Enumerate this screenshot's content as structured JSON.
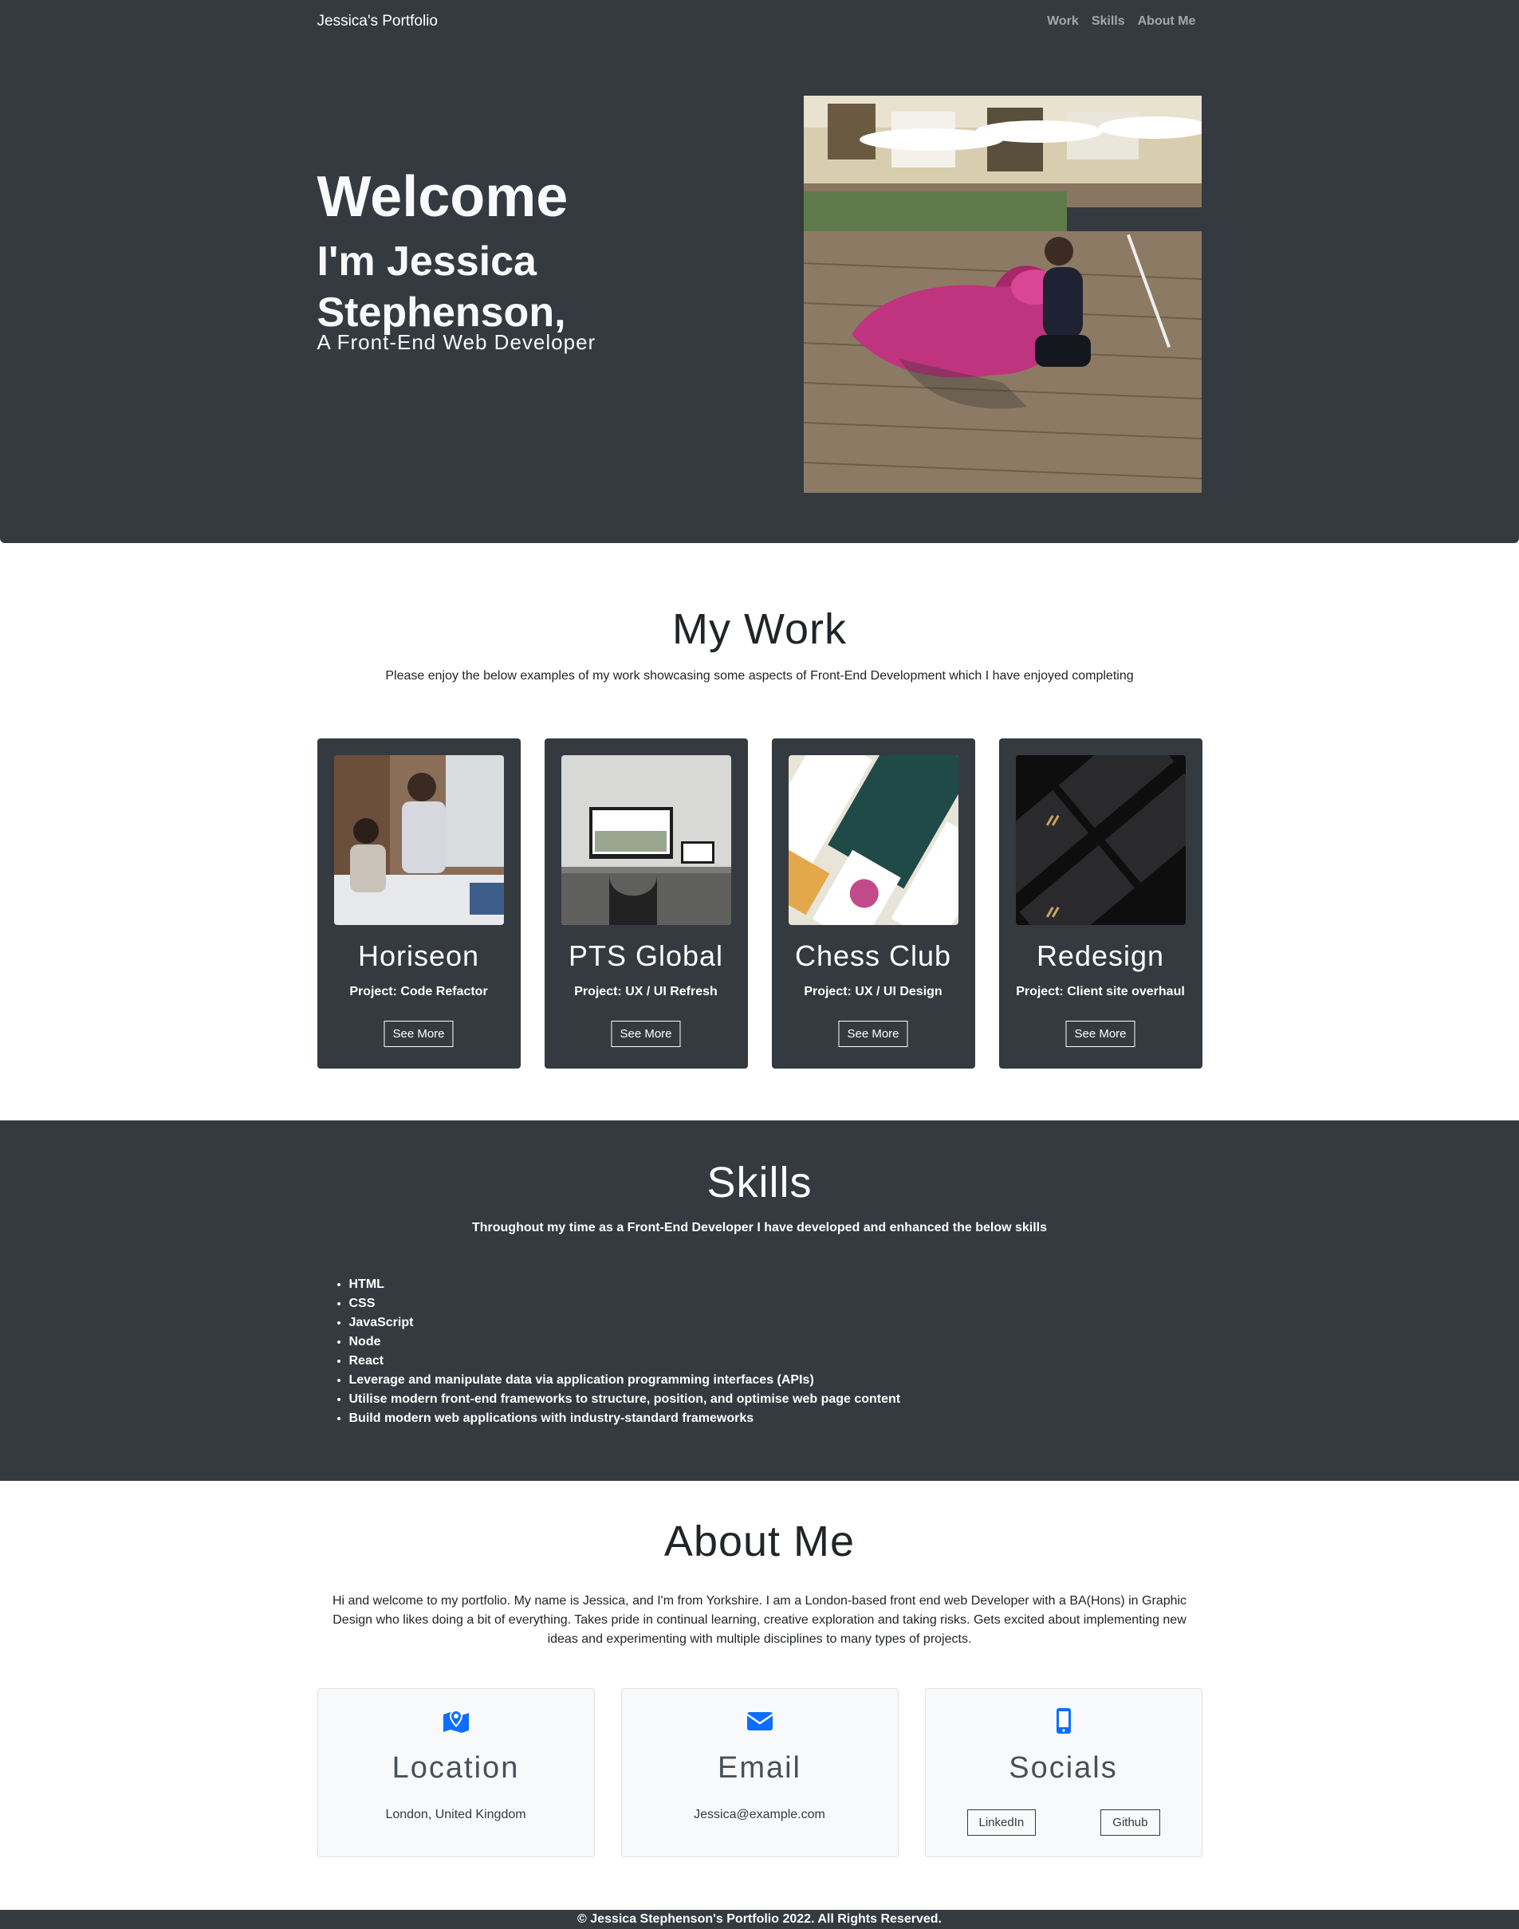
{
  "nav": {
    "brand": "Jessica's Portfolio",
    "links": [
      "Work",
      "Skills",
      "About Me"
    ]
  },
  "hero": {
    "title": "Welcome",
    "subtitle": "I'm Jessica Stephenson,",
    "role": "A Front-End Web Developer"
  },
  "work": {
    "title": "My Work",
    "lead": "Please enjoy the below examples of my work showcasing some aspects of Front-End Development which I have enjoyed completing",
    "projects": [
      {
        "title": "Horiseon",
        "subtitle": "Project: Code Refactor",
        "button": "See More"
      },
      {
        "title": "PTS Global",
        "subtitle": "Project: UX / UI Refresh",
        "button": "See More"
      },
      {
        "title": "Chess Club",
        "subtitle": "Project: UX / UI Design",
        "button": "See More"
      },
      {
        "title": "Redesign",
        "subtitle": "Project: Client site overhaul",
        "button": "See More"
      }
    ]
  },
  "skills": {
    "title": "Skills",
    "lead": "Throughout my time as a Front-End Developer I have developed and enhanced the below skills",
    "items": [
      "HTML",
      "CSS",
      "JavaScript",
      "Node",
      "React",
      "Leverage and manipulate data via application programming interfaces (APIs)",
      "Utilise modern front-end frameworks to structure, position, and optimise web page content",
      "Build modern web applications with industry-standard frameworks"
    ]
  },
  "about": {
    "title": "About Me",
    "text": "Hi and welcome to my portfolio. My name is Jessica, and I'm from Yorkshire. I am a London-based front end web Developer with a BA(Hons) in Graphic Design who likes doing a bit of everything. Takes pride in continual learning, creative exploration and taking risks. Gets excited about implementing new ideas and experimenting with multiple disciplines to many types of projects.",
    "location": {
      "title": "Location",
      "value": "London, United Kingdom",
      "icon": "map-marker-icon"
    },
    "email": {
      "title": "Email",
      "value": "Jessica@example.com",
      "icon": "envelope-icon"
    },
    "socials": {
      "title": "Socials",
      "buttons": [
        "LinkedIn",
        "Github"
      ],
      "icon": "mobile-phone-icon"
    }
  },
  "footer": {
    "text": "© Jessica Stephenson's Portfolio 2022. All Rights Reserved."
  },
  "colors": {
    "dark": "#343a40",
    "accent": "#0d6efd",
    "light": "#f8f9fa"
  }
}
